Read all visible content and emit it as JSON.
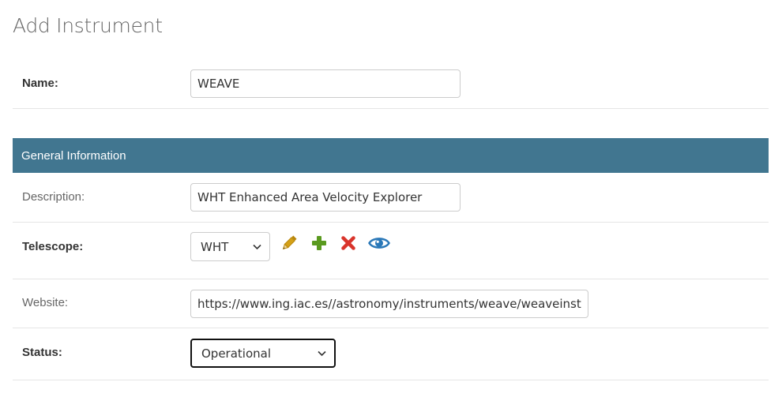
{
  "page": {
    "title": "Add Instrument"
  },
  "fields": {
    "name": {
      "label": "Name:",
      "value": "WEAVE"
    },
    "section_general": {
      "title": "General Information"
    },
    "description": {
      "label": "Description:",
      "value": "WHT Enhanced Area Velocity Explorer"
    },
    "telescope": {
      "label": "Telescope:",
      "selected": "WHT",
      "actions": [
        "pencil-icon",
        "plus-icon",
        "x-icon",
        "eye-icon"
      ]
    },
    "website": {
      "label": "Website:",
      "value": "https://www.ing.iac.es//astronomy/instruments/weave/weaveinst.htr"
    },
    "status": {
      "label": "Status:",
      "selected": "Operational"
    }
  },
  "colors": {
    "section_header": "#417690",
    "pencil": "#b8860b",
    "plus": "#5a9a1f",
    "delete": "#d9342b",
    "view": "#2a78b8"
  }
}
